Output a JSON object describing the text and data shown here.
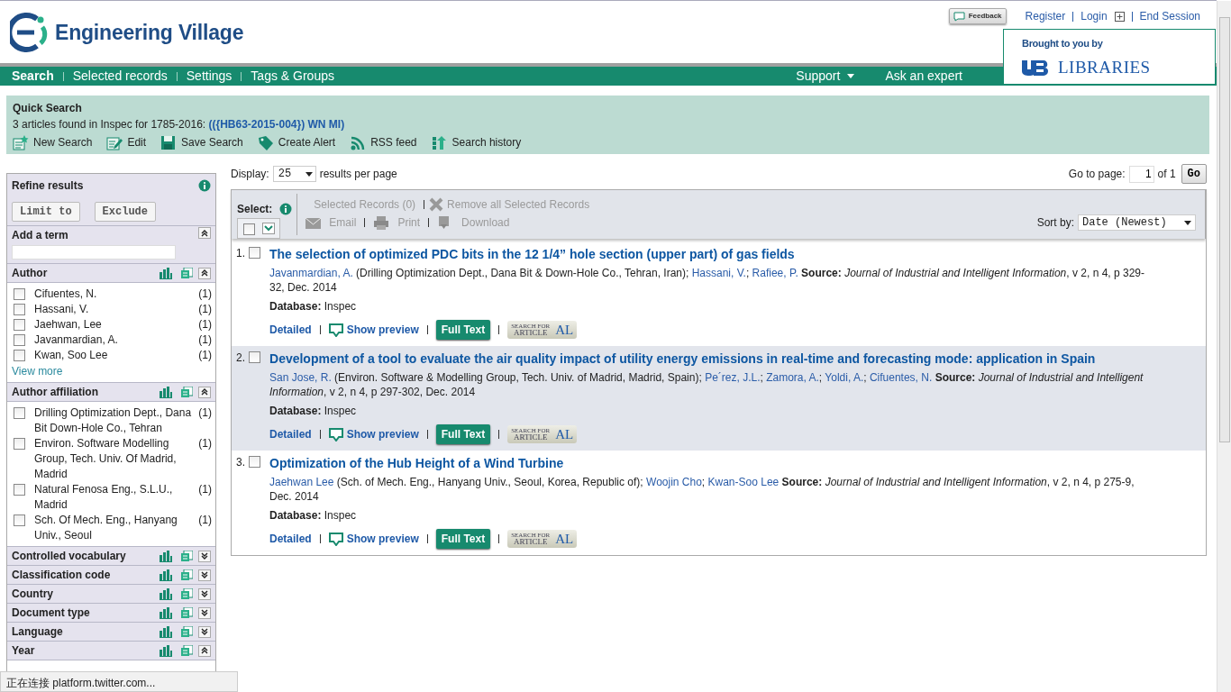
{
  "header": {
    "logo": "Engineering Village",
    "feedback": "Feedback",
    "links": [
      {
        "label": "Register",
        "kind": "link"
      },
      {
        "label": "Login",
        "kind": "login"
      },
      {
        "label": "End Session",
        "kind": "link"
      }
    ]
  },
  "sponsor": {
    "caption": "Brought to you by",
    "name": "LIBRARIES"
  },
  "nav": {
    "left": [
      {
        "label": "Search",
        "selected": true
      },
      {
        "label": "Selected records",
        "selected": false
      },
      {
        "label": "Settings",
        "selected": false
      },
      {
        "label": "Tags & Groups",
        "selected": false
      }
    ],
    "right": [
      {
        "label": "Support",
        "dropdown": true
      },
      {
        "label": "Ask an expert",
        "dropdown": false
      }
    ]
  },
  "quick_search": {
    "title": "Quick Search",
    "summary": "3 articles found in Inspec for 1785-2016:",
    "query": "(({HB63-2015-004}) WN MI)",
    "actions": [
      {
        "label": "New Search",
        "kind": "new"
      },
      {
        "label": "Edit",
        "kind": "edit"
      },
      {
        "label": "Save Search",
        "kind": "save"
      },
      {
        "label": "Create Alert",
        "kind": "alert"
      },
      {
        "label": "RSS feed",
        "kind": "rss"
      },
      {
        "label": "Search history",
        "kind": "history"
      }
    ]
  },
  "refine": {
    "title": "Refine results",
    "buttons": [
      "Limit to",
      "Exclude"
    ],
    "add_term": "Add a term",
    "facets": [
      {
        "title": "Author",
        "expanded": true,
        "items": [
          {
            "label": "Cifuentes, N.",
            "count": "(1)",
            "checked": false
          },
          {
            "label": "Hassani, V.",
            "count": "(1)",
            "checked": false
          },
          {
            "label": "Jaehwan, Lee",
            "count": "(1)",
            "checked": false
          },
          {
            "label": "Javanmardian, A.",
            "count": "(1)",
            "checked": false
          },
          {
            "label": "Kwan, Soo Lee",
            "count": "(1)",
            "checked": false
          }
        ],
        "more": "View more"
      },
      {
        "title": "Author affiliation",
        "expanded": true,
        "items": [
          {
            "label": "Drilling Optimization Dept., Dana Bit Down-Hole Co., Tehran",
            "count": "(1)",
            "checked": false
          },
          {
            "label": "Environ. Software Modelling Group, Tech. Univ. Of Madrid, Madrid",
            "count": "(1)",
            "checked": false
          },
          {
            "label": "Natural Fenosa Eng., S.L.U., Madrid",
            "count": "(1)",
            "checked": false
          },
          {
            "label": "Sch. Of Mech. Eng., Hanyang Univ., Seoul",
            "count": "(1)",
            "checked": false
          }
        ]
      },
      {
        "title": "Controlled vocabulary",
        "expanded": false
      },
      {
        "title": "Classification code",
        "expanded": false
      },
      {
        "title": "Country",
        "expanded": false
      },
      {
        "title": "Document type",
        "expanded": false
      },
      {
        "title": "Language",
        "expanded": false
      },
      {
        "title": "Year",
        "expanded": true
      }
    ]
  },
  "display": {
    "label": "Display:",
    "value": "25",
    "suffix": "results per page",
    "goto_label": "Go to page:",
    "page": "1",
    "of": "of 1",
    "go": "Go"
  },
  "select_bar": {
    "label": "Select:",
    "select_all_checked": false,
    "selected_records": "Selected Records (0)",
    "remove": "Remove all Selected Records",
    "disabled": true,
    "actions": [
      {
        "label": "Email",
        "kind": "email"
      },
      {
        "label": "Print",
        "kind": "print"
      },
      {
        "label": "Download",
        "kind": "download"
      }
    ],
    "sort_label": "Sort by:",
    "sort_value": "Date (Newest)"
  },
  "results": [
    {
      "number": "1.",
      "checked": false,
      "highlighted": false,
      "title": "The selection of optimized PDC bits in the 12 1/4” hole section (upper part) of gas fields",
      "authors": [
        {
          "name": "Javanmardian, A.",
          "affiliation": "(Drilling Optimization Dept., Dana Bit & Down-Hole Co., Tehran, Iran)",
          "separator": ";"
        },
        {
          "name": "Hassani, V.",
          "separator": ";"
        },
        {
          "name": "Rafiee, P."
        }
      ],
      "source_label": "Source:",
      "journal": "Journal of Industrial and Intelligent Information",
      "details": ", v 2, n 4, p 329-32, Dec. 2014",
      "database_label": "Database:",
      "database": "Inspec",
      "links": {
        "detailed": "Detailed",
        "preview": "Show preview",
        "full_text": "Full Text",
        "sfx_top": "SEARCH FOR",
        "sfx_bottom": "ARTICLE",
        "sfx_mark": "AL"
      }
    },
    {
      "number": "2.",
      "checked": false,
      "highlighted": true,
      "title": "Development of a tool to evaluate the air quality impact of utility energy emissions in real-time and forecasting mode: application in Spain",
      "authors": [
        {
          "name": "San Jose, R.",
          "affiliation": "(Environ. Software & Modelling Group, Tech. Univ. of Madrid, Madrid, Spain)",
          "separator": ";"
        },
        {
          "name": "Pe´rez, J.L.",
          "separator": ";"
        },
        {
          "name": "Zamora, A.",
          "separator": ";"
        },
        {
          "name": "Yoldi, A.",
          "separator": ";"
        },
        {
          "name": "Cifuentes, N."
        }
      ],
      "source_label": "Source:",
      "journal": "Journal of Industrial and Intelligent Information",
      "details": ", v 2, n 4, p 297-302, Dec. 2014",
      "database_label": "Database:",
      "database": "Inspec",
      "links": {
        "detailed": "Detailed",
        "preview": "Show preview",
        "full_text": "Full Text",
        "sfx_top": "SEARCH FOR",
        "sfx_bottom": "ARTICLE",
        "sfx_mark": "AL"
      }
    },
    {
      "number": "3.",
      "checked": false,
      "highlighted": false,
      "title": "Optimization of the Hub Height of a Wind Turbine",
      "authors": [
        {
          "name": "Jaehwan Lee",
          "affiliation": "(Sch. of Mech. Eng., Hanyang Univ., Seoul, Korea, Republic of)",
          "separator": ";"
        },
        {
          "name": "Woojin Cho",
          "separator": ";"
        },
        {
          "name": "Kwan-Soo Lee"
        }
      ],
      "source_label": "Source:",
      "journal": "Journal of Industrial and Intelligent Information",
      "details": ", v 2, n 4, p 275-9, Dec. 2014",
      "database_label": "Database:",
      "database": "Inspec",
      "links": {
        "detailed": "Detailed",
        "preview": "Show preview",
        "full_text": "Full Text",
        "sfx_top": "SEARCH FOR",
        "sfx_bottom": "ARTICLE",
        "sfx_mark": "AL"
      }
    }
  ],
  "status_bar": "正在连接 platform.twitter.com..."
}
